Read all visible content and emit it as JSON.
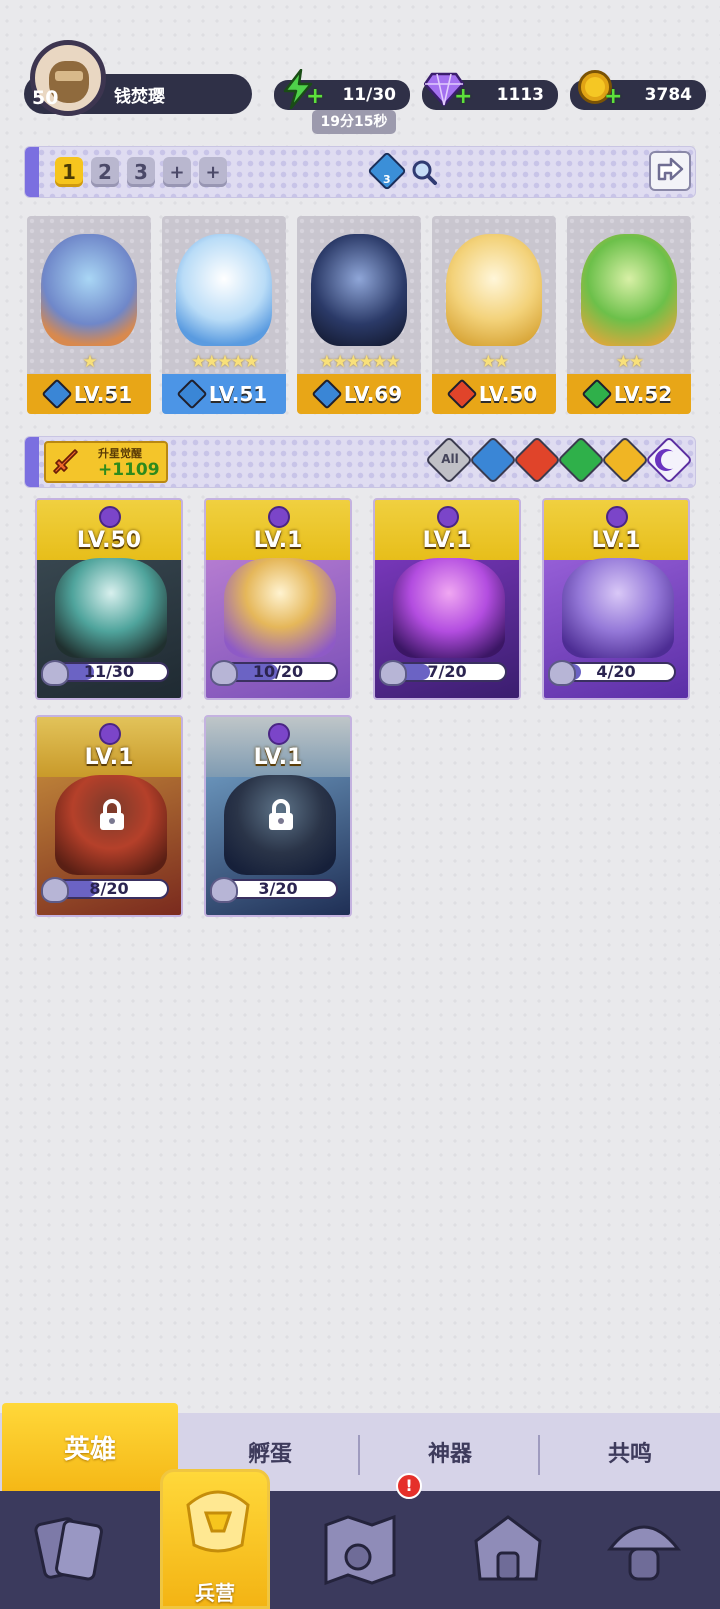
{
  "profile": {
    "level": "50",
    "name": "钱焚璎"
  },
  "resources": {
    "energy": {
      "value": "11/30",
      "timer": "19分15秒",
      "icon": "lightning-icon"
    },
    "gems": {
      "value": "1113",
      "icon": "gem-icon"
    },
    "coins": {
      "value": "3784",
      "icon": "coin-icon"
    }
  },
  "team_bar": {
    "tabs": [
      "1",
      "2",
      "3"
    ],
    "add_buttons": [
      "+",
      "+"
    ],
    "active_index": 0,
    "crystal_count": "3",
    "search_icon": "magnifier-icon",
    "share_icon": "share-icon"
  },
  "team": [
    {
      "level": "LV.51",
      "stars": "★",
      "element": "water"
    },
    {
      "level": "LV.51",
      "stars": "★★★★★",
      "element": "water"
    },
    {
      "level": "LV.69",
      "stars": "★★★★★★",
      "element": "water"
    },
    {
      "level": "LV.50",
      "stars": "★★",
      "element": "fire"
    },
    {
      "level": "LV.52",
      "stars": "★★",
      "element": "nature"
    }
  ],
  "awaken": {
    "label": "升星觉醒",
    "value": "+1109"
  },
  "filters": {
    "all_label": "All",
    "options": [
      "water",
      "fire",
      "nature",
      "light",
      "dark"
    ],
    "active": "dark"
  },
  "roster": [
    {
      "level": "LV.50",
      "progress": "11/30",
      "ratio": 0.37,
      "locked": false
    },
    {
      "level": "LV.1",
      "progress": "10/20",
      "ratio": 0.5,
      "locked": false
    },
    {
      "level": "LV.1",
      "progress": "7/20",
      "ratio": 0.35,
      "locked": false
    },
    {
      "level": "LV.1",
      "progress": "4/20",
      "ratio": 0.2,
      "locked": false
    },
    {
      "level": "LV.1",
      "progress": "8/20",
      "ratio": 0.4,
      "locked": true
    },
    {
      "level": "LV.1",
      "progress": "3/20",
      "ratio": 0.15,
      "locked": true
    }
  ],
  "tabs": [
    "英雄",
    "孵蛋",
    "神器",
    "共鸣"
  ],
  "bottom_nav": {
    "active_label": "兵营",
    "badge": "!",
    "items": [
      "cards-icon",
      "barracks-icon",
      "map-icon",
      "castle-icon",
      "mushroom-icon"
    ]
  },
  "colors": {
    "accent": "#f6c51e",
    "nav_bg": "#3b3a5d",
    "pill_bg": "#2f3047",
    "bar": "#7b6fe0"
  }
}
